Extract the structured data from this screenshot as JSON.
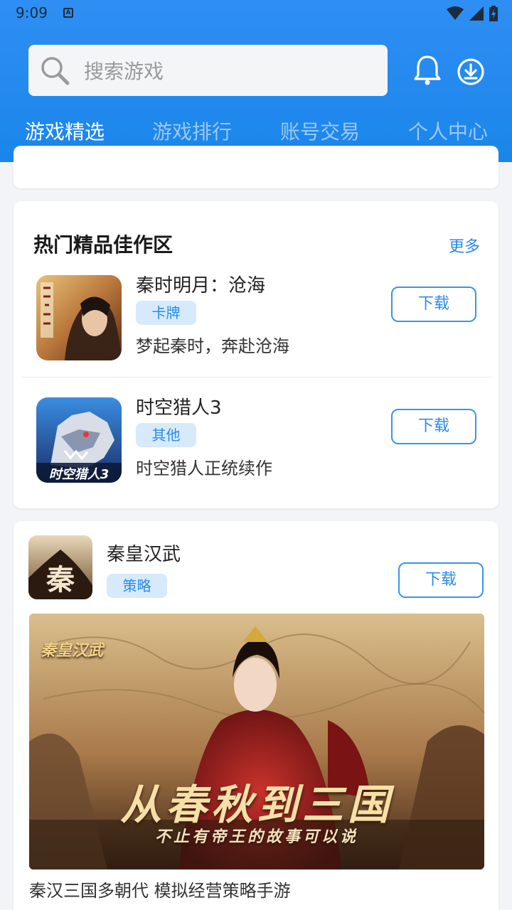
{
  "status_bar": {
    "time": "9:09",
    "app_badge": "A"
  },
  "search": {
    "placeholder": "搜索游戏"
  },
  "tabs": [
    {
      "label": "游戏精选",
      "active": true
    },
    {
      "label": "游戏排行",
      "active": false
    },
    {
      "label": "账号交易",
      "active": false
    },
    {
      "label": "个人中心",
      "active": false
    }
  ],
  "hot_section": {
    "title": "热门精品佳作区",
    "more": "更多",
    "games": [
      {
        "name": "秦时明月：沧海",
        "tag": "卡牌",
        "desc": "梦起秦时，奔赴沧海",
        "button": "下载",
        "icon": "qinshi-mingyue-game-icon"
      },
      {
        "name": "时空猎人3",
        "tag": "其他",
        "desc": "时空猎人正统续作",
        "button": "下载",
        "icon": "shikong-lieren-game-icon",
        "icon_caption": "时空猎人3"
      }
    ]
  },
  "featured": {
    "name": "秦皇汉武",
    "tag": "策略",
    "button": "下载",
    "icon_glyph": "秦",
    "banner": {
      "logo_text": "秦皇汉武",
      "headline": "从春秋到三国",
      "subline": "不止有帝王的故事可以说"
    },
    "desc": "秦汉三国多朝代 模拟经营策略手游"
  },
  "colors": {
    "accent": "#2a8be8",
    "header": "#2f8ef3",
    "tag_bg": "#d6eafc"
  }
}
